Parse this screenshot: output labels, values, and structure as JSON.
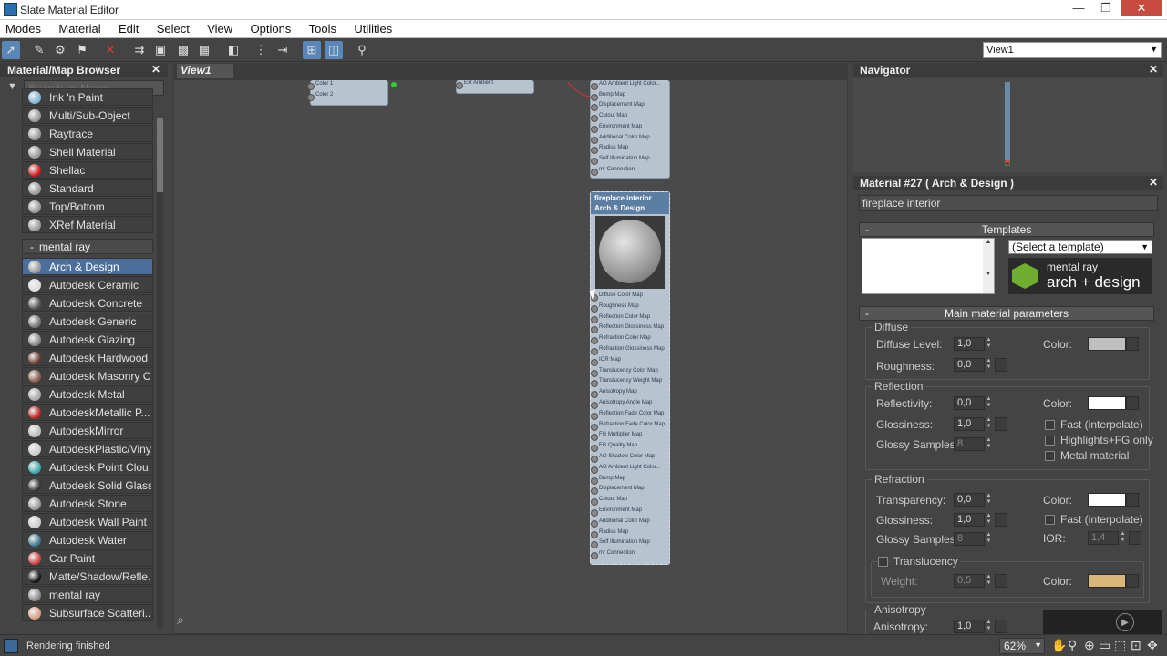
{
  "window": {
    "title": "Slate Material Editor",
    "min": "—",
    "max": "❐",
    "close": "✕"
  },
  "menu": [
    "Modes",
    "Material",
    "Edit",
    "Select",
    "View",
    "Options",
    "Tools",
    "Utilities"
  ],
  "toolbar": {
    "view_dropdown": "View1"
  },
  "browser": {
    "title": "Material/Map Browser",
    "close": "✕",
    "search_placeholder": "Search by Name ...",
    "items_top": [
      {
        "label": "Ink 'n Paint",
        "color": "#7fb6d8"
      },
      {
        "label": "Multi/Sub-Object",
        "color": "#999999"
      },
      {
        "label": "Raytrace",
        "color": "#999999"
      },
      {
        "label": "Shell Material",
        "color": "#999999"
      },
      {
        "label": "Shellac",
        "color": "#d01818"
      },
      {
        "label": "Standard",
        "color": "#999999"
      },
      {
        "label": "Top/Bottom",
        "color": "#999999"
      },
      {
        "label": "XRef Material",
        "color": "#999999"
      }
    ],
    "group_label": "mental ray",
    "group_toggle": "-",
    "items_mr": [
      {
        "label": "Arch & Design",
        "color": "#999999",
        "selected": true
      },
      {
        "label": "Autodesk Ceramic",
        "color": "#dddddd"
      },
      {
        "label": "Autodesk Concrete",
        "color": "#555555"
      },
      {
        "label": "Autodesk Generic",
        "color": "#777777"
      },
      {
        "label": "Autodesk Glazing",
        "color": "#888888"
      },
      {
        "label": "Autodesk Hardwood",
        "color": "#6a3a2a"
      },
      {
        "label": "Autodesk Masonry C...",
        "color": "#8a5a4a"
      },
      {
        "label": "Autodesk Metal",
        "color": "#aaaaaa"
      },
      {
        "label": "AutodeskMetallic P...",
        "color": "#c02020"
      },
      {
        "label": "AutodeskMirror",
        "color": "#bbbbbb"
      },
      {
        "label": "AutodeskPlastic/Vinyl",
        "color": "#cccccc"
      },
      {
        "label": "Autodesk Point Clou...",
        "color": "#3aaab0"
      },
      {
        "label": "Autodesk Solid Glass",
        "color": "#333333"
      },
      {
        "label": "Autodesk Stone",
        "color": "#999999"
      },
      {
        "label": "Autodesk Wall Paint",
        "color": "#cccccc"
      },
      {
        "label": "Autodesk Water",
        "color": "#3a7a8a"
      },
      {
        "label": "Car Paint",
        "color": "#d04040"
      },
      {
        "label": "Matte/Shadow/Refle...",
        "color": "#111111"
      },
      {
        "label": "mental ray",
        "color": "#888888"
      },
      {
        "label": "Subsurface Scatteri...",
        "color": "#d8a080"
      }
    ]
  },
  "view": {
    "tab": "View1",
    "node_top_small": {
      "ports": [
        "Color 1",
        "Color 2"
      ]
    },
    "node_top_small2": {
      "ports": [
        "Ext Ambient"
      ]
    },
    "node_top_ports": [
      "AO Ambient Light Color...",
      "Bump Map",
      "Displacement Map",
      "Cutout Map",
      "Environment Map",
      "Additional Color Map",
      "Radius Map",
      "Self Illumination Map",
      "mr Connection"
    ],
    "node_main": {
      "title": "fireplace interior",
      "subtitle": "Arch & Design",
      "ports": [
        "Diffuse Color Map",
        "Roughness Map",
        "Reflection Color Map",
        "Reflection Glossiness Map",
        "Refraction Color Map",
        "Refraction Glossiness Map",
        "IOR Map",
        "Translucency Color Map",
        "Translucency Weight Map",
        "Anisotropy Map",
        "Anisotropy Angle Map",
        "Reflection Fade Color Map",
        "Refraction Fade Color Map",
        "FG Multiplier Map",
        "FG Quality Map",
        "AO Shadow Color Map",
        "AO Ambient Light Color...",
        "Bump Map",
        "Displacement Map",
        "Cutout Map",
        "Environment Map",
        "Additional Color Map",
        "Radius Map",
        "Self Illumination Map",
        "mr Connection"
      ]
    }
  },
  "navigator": {
    "title": "Navigator",
    "close": "✕"
  },
  "props": {
    "title": "Material #27  ( Arch & Design )",
    "close": "✕",
    "name": "fireplace interior",
    "templates_label": "Templates",
    "template_select": "(Select a template)",
    "logo_line1": "mental ray",
    "logo_line2": "arch + design",
    "main_label": "Main material parameters",
    "rollout_toggle": "-",
    "diffuse": {
      "group": "Diffuse",
      "level_label": "Diffuse Level:",
      "level": "1,0",
      "rough_label": "Roughness:",
      "rough": "0,0",
      "color_label": "Color:",
      "color": "#bfbfbf"
    },
    "reflection": {
      "group": "Reflection",
      "refl_label": "Reflectivity:",
      "refl": "0,0",
      "gloss_label": "Glossiness:",
      "gloss": "1,0",
      "samples_label": "Glossy Samples:",
      "samples": "8",
      "color_label": "Color:",
      "color": "#ffffff",
      "fast": "Fast (interpolate)",
      "hl": "Highlights+FG only",
      "metal": "Metal material"
    },
    "refraction": {
      "group": "Refraction",
      "trans_label": "Transparency:",
      "trans": "0,0",
      "gloss_label": "Glossiness:",
      "gloss": "1,0",
      "samples_label": "Glossy Samples:",
      "samples": "8",
      "color_label": "Color:",
      "color": "#ffffff",
      "fast": "Fast (interpolate)",
      "ior_label": "IOR:",
      "ior": "1,4"
    },
    "translucency": {
      "label": "Translucency",
      "weight_label": "Weight:",
      "weight": "0,5",
      "color_label": "Color:",
      "color": "#d9b77a"
    },
    "anisotropy": {
      "group": "Anisotropy",
      "label": "Anisotropy:",
      "value": "1,0"
    }
  },
  "status": {
    "text": "Rendering finished",
    "zoom": "62%"
  }
}
